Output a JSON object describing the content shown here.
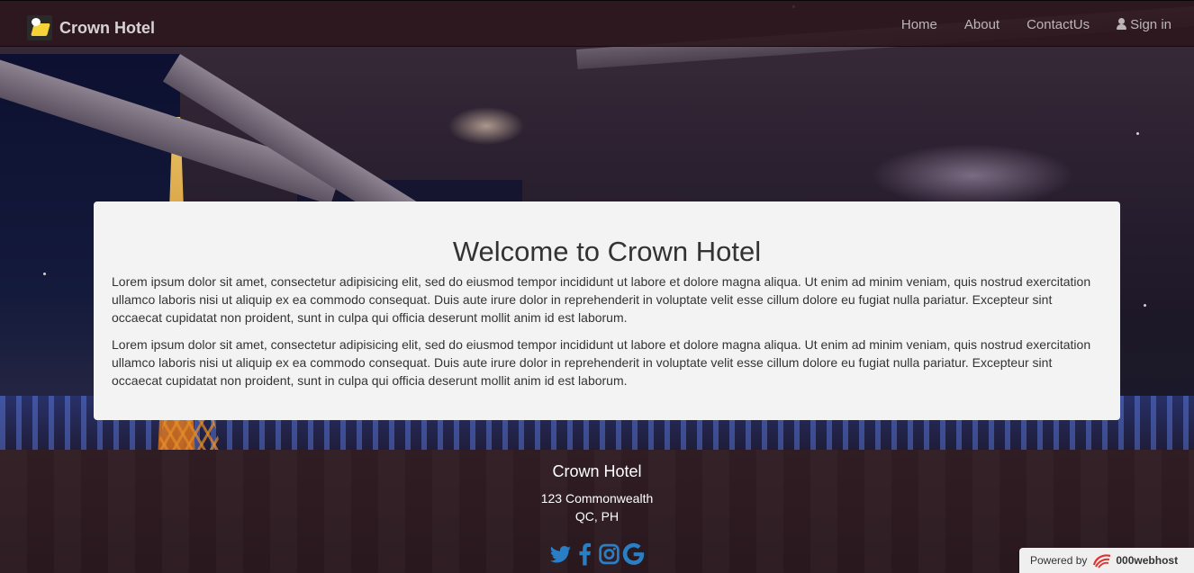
{
  "navbar": {
    "brand": "Crown Hotel",
    "links": [
      {
        "label": "Home"
      },
      {
        "label": "About"
      },
      {
        "label": "ContactUs"
      },
      {
        "label": "Sign in",
        "icon": "user-icon"
      }
    ]
  },
  "welcome": {
    "title": "Welcome to Crown Hotel",
    "paragraphs": [
      "Lorem ipsum dolor sit amet, consectetur adipisicing elit, sed do eiusmod tempor incididunt ut labore et dolore magna aliqua. Ut enim ad minim veniam, quis nostrud exercitation ullamco laboris nisi ut aliquip ex ea commodo consequat. Duis aute irure dolor in reprehenderit in voluptate velit esse cillum dolore eu fugiat nulla pariatur. Excepteur sint occaecat cupidatat non proident, sunt in culpa qui officia deserunt mollit anim id est laborum.",
      "Lorem ipsum dolor sit amet, consectetur adipisicing elit, sed do eiusmod tempor incididunt ut labore et dolore magna aliqua. Ut enim ad minim veniam, quis nostrud exercitation ullamco laboris nisi ut aliquip ex ea commodo consequat. Duis aute irure dolor in reprehenderit in voluptate velit esse cillum dolore eu fugiat nulla pariatur. Excepteur sint occaecat cupidatat non proident, sunt in culpa qui officia deserunt mollit anim id est laborum."
    ]
  },
  "footer": {
    "title": "Crown Hotel",
    "address_line1": "123 Commonwealth",
    "address_line2": "QC, PH",
    "social": [
      "twitter-icon",
      "facebook-icon",
      "instagram-icon",
      "google-icon"
    ]
  },
  "powered_by": {
    "label": "Powered by",
    "brand": "000webhost"
  },
  "colors": {
    "social_blue": "#2a7fc4",
    "navbar_bg": "#2c161c",
    "panel_bg": "#f3f3f3"
  }
}
